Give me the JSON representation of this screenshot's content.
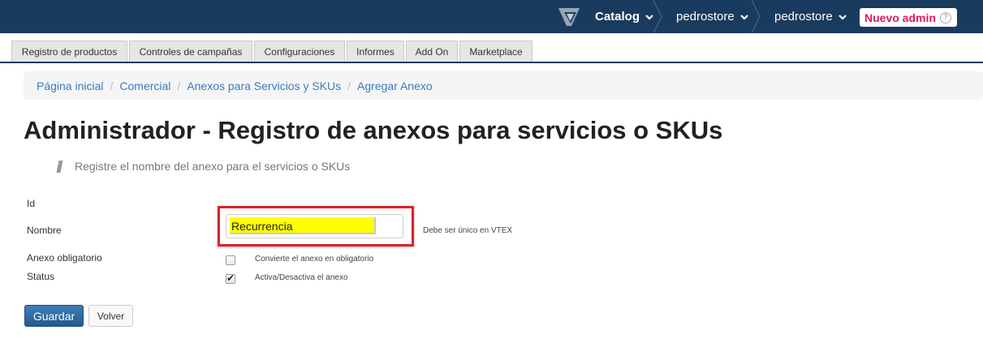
{
  "topbar": {
    "logo_icon": "vtex-logo-icon",
    "catalog_label": "Catalog",
    "store1_label": "pedrostore",
    "store2_label": "pedrostore",
    "nuevo_admin_label": "Nuevo admin",
    "help_icon": "question-circle-icon",
    "accent_color": "#e2165e",
    "background_color": "#193b5e"
  },
  "tabs": [
    {
      "label": "Registro de productos"
    },
    {
      "label": "Controles de campañas"
    },
    {
      "label": "Configuraciones"
    },
    {
      "label": "Informes"
    },
    {
      "label": "Add On"
    },
    {
      "label": "Marketplace"
    }
  ],
  "breadcrumb": {
    "items": [
      "Página inicial",
      "Comercial",
      "Anexos para Servicios y SKUs",
      "Agregar Anexo"
    ],
    "separator": "/"
  },
  "page": {
    "title": "Administrador - Registro de anexos para servicios o SKUs",
    "subtitle": "Registre el nombre del anexo para el servicios o SKUs"
  },
  "form": {
    "id_label": "Id",
    "nombre_label": "Nombre",
    "nombre_value": "Recurrencia",
    "nombre_hint": "Debe ser único en VTEX",
    "anexo_label": "Anexo obligatorio",
    "anexo_hint": "Convierte el anexo en obligatorio",
    "anexo_checked": false,
    "status_label": "Status",
    "status_hint": "Activa/Desactiva el anexo",
    "status_checked": true,
    "status_checkmark": "✔"
  },
  "actions": {
    "save_label": "Guardar",
    "back_label": "Volver",
    "save_color": "#2b6aa3"
  }
}
